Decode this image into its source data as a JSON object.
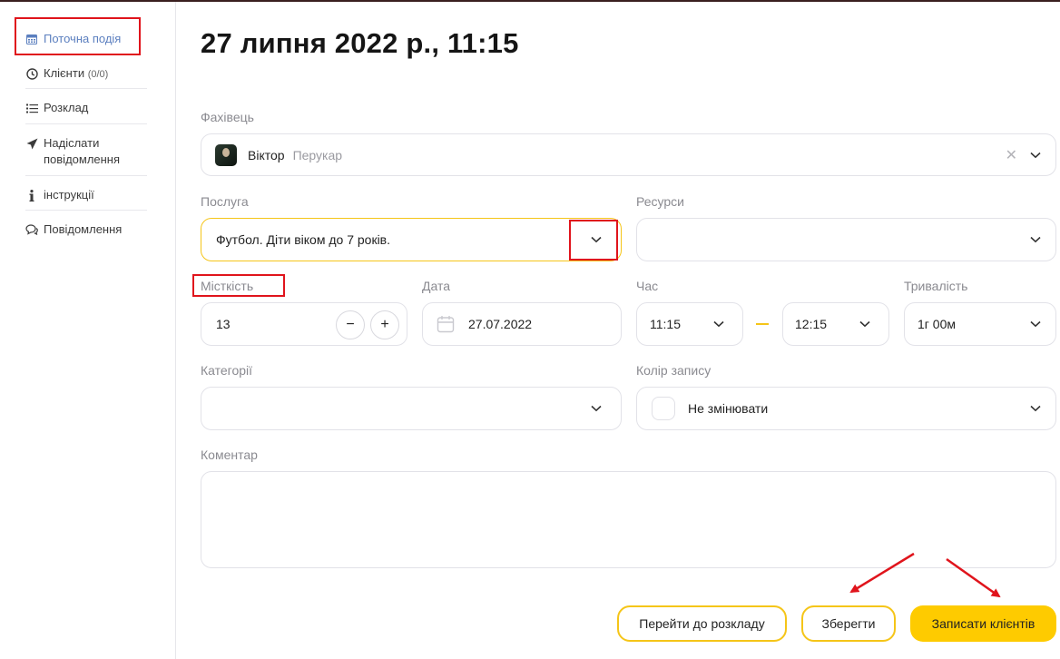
{
  "sidebar": {
    "items": [
      {
        "label": "Поточна подія",
        "icon": "calendar-icon"
      },
      {
        "label": "Клієнти",
        "count": "(0/0)",
        "icon": "clock-icon"
      },
      {
        "label": "Розклад",
        "icon": "list-icon"
      },
      {
        "label": "Надіслати повідомлення",
        "icon": "send-icon"
      },
      {
        "label": "інструкції",
        "icon": "info-icon"
      },
      {
        "label": "Повідомлення",
        "icon": "chat-icon"
      }
    ]
  },
  "header": {
    "title": "27 липня 2022 р., 11:15"
  },
  "form": {
    "specialist": {
      "label": "Фахівець",
      "name": "Віктор",
      "role": "Перукар",
      "clear": "✕"
    },
    "service": {
      "label": "Послуга",
      "value": "Футбол. Діти віком до 7 років."
    },
    "resources": {
      "label": "Ресурси",
      "value": ""
    },
    "capacity": {
      "label": "Місткість",
      "value": "13",
      "minus": "−",
      "plus": "+"
    },
    "date": {
      "label": "Дата",
      "value": "27.07.2022"
    },
    "time": {
      "label": "Час",
      "start": "11:15",
      "end": "12:15"
    },
    "duration": {
      "label": "Тривалість",
      "value": "1г 00м"
    },
    "categories": {
      "label": "Категорії",
      "value": ""
    },
    "record_color": {
      "label": "Колір запису",
      "value": "Не змінювати"
    },
    "comment": {
      "label": "Коментар",
      "value": ""
    }
  },
  "actions": {
    "schedule": "Перейти до розкладу",
    "save": "Зберегти",
    "book": "Записати клієнтів"
  },
  "colors": {
    "accent": "#fecb00",
    "highlight": "#e0141c",
    "active_link": "#5b7fbf"
  }
}
